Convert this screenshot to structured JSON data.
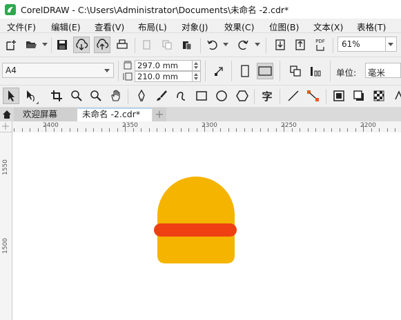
{
  "window": {
    "title": "CorelDRAW - C:\\Users\\Administrator\\Documents\\未命名 -2.cdr*"
  },
  "menu": [
    {
      "label": "文件(F)"
    },
    {
      "label": "编辑(E)"
    },
    {
      "label": "查看(V)"
    },
    {
      "label": "布局(L)"
    },
    {
      "label": "对象(J)"
    },
    {
      "label": "效果(C)"
    },
    {
      "label": "位图(B)"
    },
    {
      "label": "文本(X)"
    },
    {
      "label": "表格(T)"
    }
  ],
  "toolbar": {
    "zoom_value": "61%",
    "pdf_label": "PDF"
  },
  "property_bar": {
    "page_size": "A4",
    "width": "297.0 mm",
    "height": "210.0 mm",
    "units_label": "单位:",
    "units_value": "毫米"
  },
  "tabs": [
    {
      "label": "欢迎屏幕"
    },
    {
      "label": "未命名 -2.cdr*"
    }
  ],
  "ruler": {
    "top_labels": [
      "2400",
      "2350",
      "2300",
      "2250",
      "2200"
    ],
    "left_labels": [
      "1550",
      "1500"
    ]
  },
  "colors": {
    "shape_fill": "#F5B400",
    "band_fill": "#EE4013",
    "app_logo": "#2FA84F"
  },
  "icons": {
    "new": "new-document-icon",
    "open": "open-folder-icon",
    "save": "save-icon",
    "cloud_down": "cloud-download-icon",
    "cloud_up": "cloud-upload-icon",
    "print": "print-icon",
    "undo": "undo-icon",
    "redo": "redo-icon",
    "import": "import-icon",
    "export": "export-icon"
  }
}
